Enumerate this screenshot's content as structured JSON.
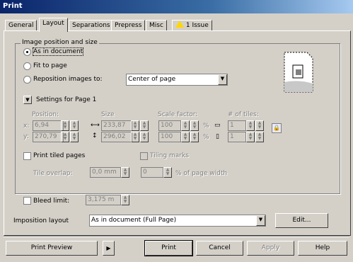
{
  "window": {
    "title": "Print"
  },
  "tabs": [
    {
      "label": "General"
    },
    {
      "label": "Layout"
    },
    {
      "label": "Separations"
    },
    {
      "label": "Prepress"
    },
    {
      "label": "Misc"
    },
    {
      "label": "1 Issue"
    }
  ],
  "image_position": {
    "group_title": "Image position and size",
    "options": [
      {
        "label": "As in document",
        "selected": true
      },
      {
        "label": "Fit to page",
        "selected": false
      },
      {
        "label": "Reposition images to:",
        "selected": false
      }
    ],
    "reposition_value": "Center of page"
  },
  "settings": {
    "label": "Settings for Page 1",
    "position_label": "Position:",
    "size_label": "Size",
    "scale_label": "Scale factor:",
    "tiles_label": "# of tiles:",
    "x_label": "x:",
    "y_label": "y:",
    "x": "6,94 mm",
    "y": "270,79 mm",
    "width": "233,87",
    "height": "296,02",
    "scale_x": "100",
    "scale_y": "100",
    "percent": "%",
    "tiles_x": "1",
    "tiles_y": "1"
  },
  "tiling": {
    "print_tiled_label": "Print tiled pages",
    "tiling_marks_label": "Tiling marks",
    "tile_overlap_label": "Tile overlap:",
    "tile_overlap_value": "0,0 mm",
    "tile_overlap_percent_value": "0",
    "percent_width_label": "% of page width"
  },
  "bleed": {
    "label": "Bleed limit:",
    "value": "3,175 m"
  },
  "imposition": {
    "label": "Imposition layout",
    "value": "As in document (Full Page)",
    "edit_label": "Edit..."
  },
  "footer": {
    "print_preview": "Print Preview",
    "print": "Print",
    "cancel": "Cancel",
    "apply": "Apply",
    "help": "Help"
  },
  "icons": {
    "issue": "warning-icon",
    "preview": "page-preview-icon",
    "lock": "lock-icon",
    "expand": "triangle-down-icon"
  }
}
